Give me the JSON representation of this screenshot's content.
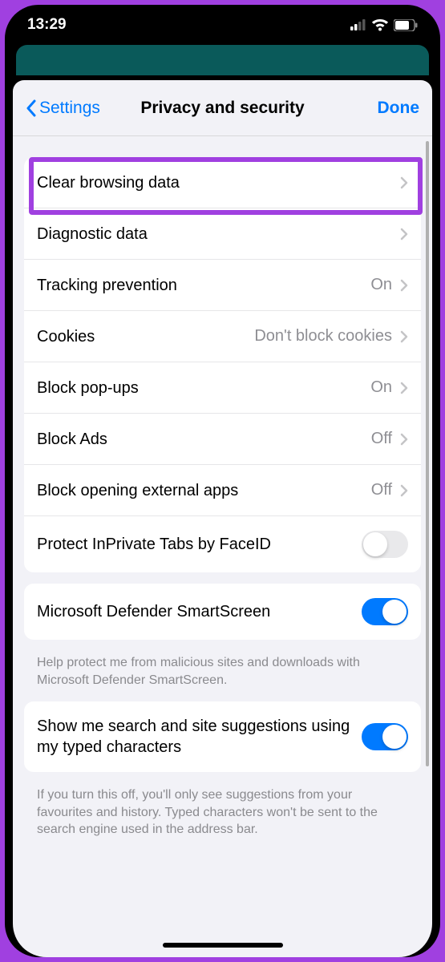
{
  "statusBar": {
    "time": "13:29"
  },
  "nav": {
    "back": "Settings",
    "title": "Privacy and security",
    "done": "Done"
  },
  "section1": {
    "rows": [
      {
        "label": "Clear browsing data",
        "value": "",
        "chevron": true
      },
      {
        "label": "Diagnostic data",
        "value": "",
        "chevron": true
      },
      {
        "label": "Tracking prevention",
        "value": "On",
        "chevron": true
      },
      {
        "label": "Cookies",
        "value": "Don't block cookies",
        "chevron": true
      },
      {
        "label": "Block pop-ups",
        "value": "On",
        "chevron": true
      },
      {
        "label": "Block Ads",
        "value": "Off",
        "chevron": true
      },
      {
        "label": "Block opening external apps",
        "value": "Off",
        "chevron": true
      },
      {
        "label": "Protect InPrivate Tabs by FaceID",
        "toggle": "off"
      }
    ]
  },
  "section2": {
    "rows": [
      {
        "label": "Microsoft Defender SmartScreen",
        "toggle": "on"
      }
    ],
    "footer": "Help protect me from malicious sites and downloads with Microsoft Defender SmartScreen."
  },
  "section3": {
    "rows": [
      {
        "label": "Show me search and site suggestions using my typed characters",
        "toggle": "on"
      }
    ],
    "footer": "If you turn this off, you'll only see suggestions from your favourites and history. Typed characters won't be sent to the search engine used in the address bar."
  }
}
